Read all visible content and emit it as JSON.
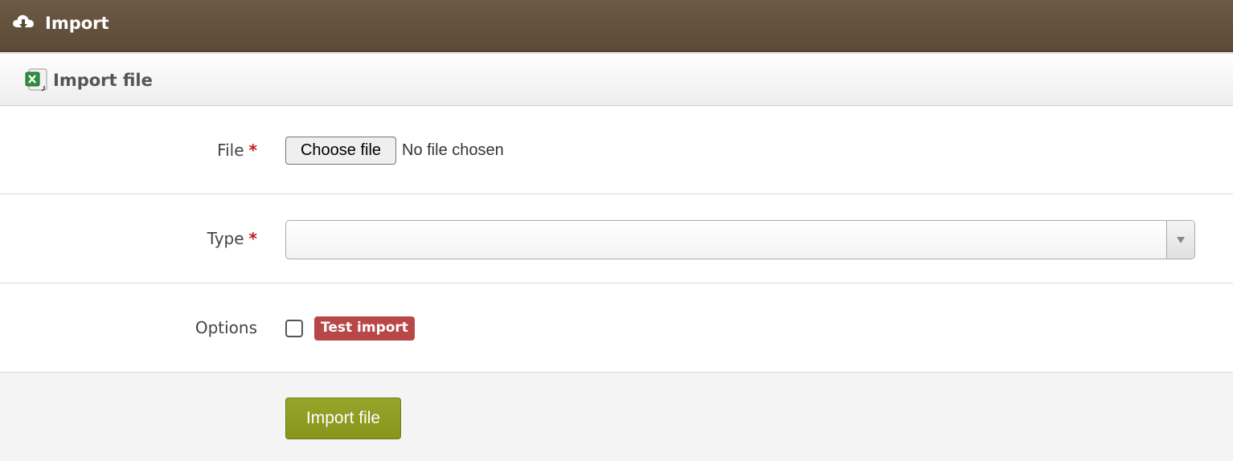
{
  "header": {
    "title": "Import",
    "icon": "cloud-download-icon"
  },
  "panel": {
    "title": "Import file",
    "icon": "excel-file-icon"
  },
  "form": {
    "file": {
      "label": "File",
      "required_mark": "*",
      "button_label": "Choose file",
      "status": "No file chosen"
    },
    "type": {
      "label": "Type",
      "required_mark": "*",
      "selected_value": ""
    },
    "options": {
      "label": "Options",
      "test_import_label": "Test import",
      "test_import_checked": false
    }
  },
  "submit": {
    "label": "Import file"
  },
  "colors": {
    "header_bg": "#5d4a36",
    "badge": "#b84747",
    "submit": "#8c9a21",
    "required": "#d0141b"
  }
}
